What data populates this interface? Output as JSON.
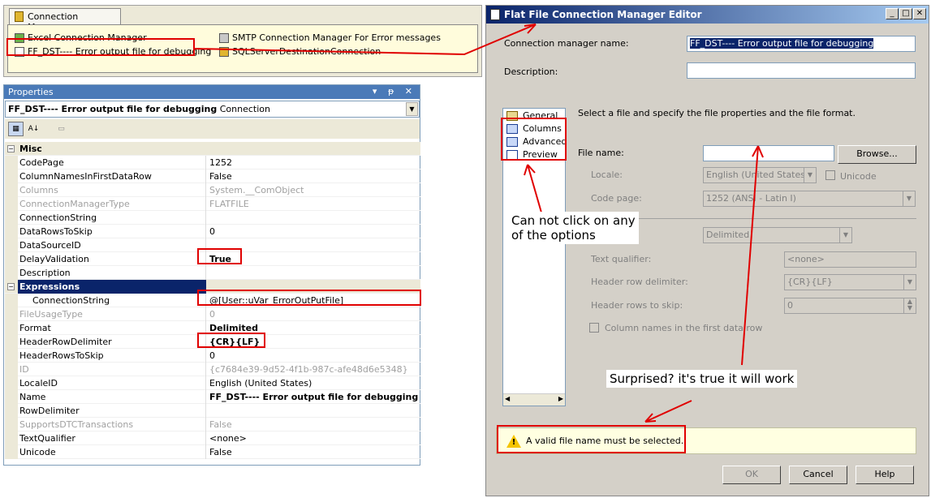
{
  "connection_managers": {
    "tab_label": "Connection Managers",
    "items": [
      "Excel Connection Manager",
      "FF_DST---- Error output file for debugging",
      "SMTP Connection Manager For Error messages",
      "SQLServerDestinationConnection"
    ]
  },
  "properties": {
    "title": "Properties",
    "title_buttons": "▾ ᵽ ✕",
    "object_name": "FF_DST---- Error output file for debugging",
    "object_type": "Connection",
    "rows": [
      {
        "k": "Misc",
        "v": "",
        "cat": true
      },
      {
        "k": "CodePage",
        "v": "1252"
      },
      {
        "k": "ColumnNamesInFirstDataRow",
        "v": "False"
      },
      {
        "k": "Columns",
        "v": "System.__ComObject",
        "gray": true
      },
      {
        "k": "ConnectionManagerType",
        "v": "FLATFILE",
        "gray": true
      },
      {
        "k": "ConnectionString",
        "v": ""
      },
      {
        "k": "DataRowsToSkip",
        "v": "0"
      },
      {
        "k": "DataSourceID",
        "v": ""
      },
      {
        "k": "DelayValidation",
        "v": "True",
        "bold": true
      },
      {
        "k": "Description",
        "v": ""
      },
      {
        "k": "Expressions",
        "v": "",
        "cat": true,
        "sel": true
      },
      {
        "k": "ConnectionString",
        "v": "@[User::uVar_ErrorOutPutFile]",
        "indent": true
      },
      {
        "k": "FileUsageType",
        "v": "0",
        "gray": true
      },
      {
        "k": "Format",
        "v": "Delimited",
        "bold": true
      },
      {
        "k": "HeaderRowDelimiter",
        "v": "{CR}{LF}",
        "bold": true
      },
      {
        "k": "HeaderRowsToSkip",
        "v": "0"
      },
      {
        "k": "ID",
        "v": "{c7684e39-9d52-4f1b-987c-afe48d6e5348}",
        "gray": true
      },
      {
        "k": "LocaleID",
        "v": "English (United States)"
      },
      {
        "k": "Name",
        "v": "FF_DST---- Error output file for debugging",
        "bold": true
      },
      {
        "k": "RowDelimiter",
        "v": ""
      },
      {
        "k": "SupportsDTCTransactions",
        "v": "False",
        "gray": true
      },
      {
        "k": "TextQualifier",
        "v": "<none>"
      },
      {
        "k": "Unicode",
        "v": "False"
      }
    ]
  },
  "editor": {
    "title": "Flat File Connection Manager Editor",
    "name_label": "Connection manager name:",
    "name_value": "FF_DST---- Error output file for debugging",
    "description_label": "Description:",
    "description_value": "",
    "nav": [
      "General",
      "Columns",
      "Advanced",
      "Preview"
    ],
    "instruction": "Select a file and specify the file properties and the file format.",
    "file_name_label": "File name:",
    "file_name_value": "",
    "browse_label": "Browse...",
    "locale_label": "Locale:",
    "locale_value": "English (United States)",
    "unicode_label": "Unicode",
    "code_page_label": "Code page:",
    "code_page_value": "1252  (ANSI - Latin I)",
    "format_value": "Delimited",
    "text_qualifier_label": "Text qualifier:",
    "text_qualifier_value": "<none>",
    "header_row_delimiter_label": "Header row delimiter:",
    "header_row_delimiter_value": "{CR}{LF}",
    "header_rows_skip_label": "Header rows to skip:",
    "header_rows_skip_value": "0",
    "column_names_label": "Column names in the first data row",
    "warning": "A valid file name must be selected.",
    "ok_label": "OK",
    "cancel_label": "Cancel",
    "help_label": "Help"
  },
  "annotations": {
    "can_not_click_1": "Can not click on any",
    "can_not_click_2": "of the options",
    "surprised": "Surprised? it's true it will work"
  },
  "colors": {
    "annotation_red": "#e00000",
    "title_blue": "#0a246a",
    "warning_bg": "#ffffe1"
  }
}
